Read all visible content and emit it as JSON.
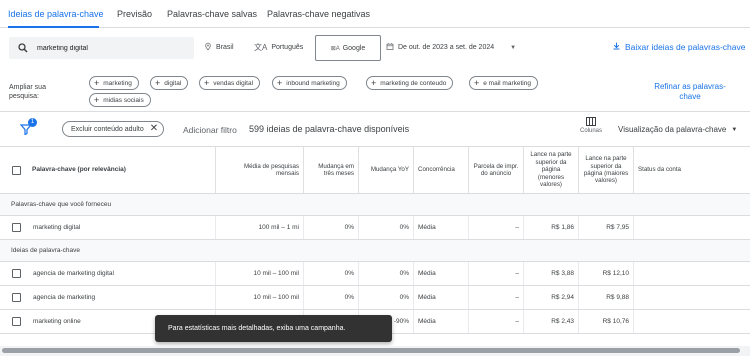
{
  "tabs": [
    {
      "label": "Ideias de palavra-chave",
      "active": true
    },
    {
      "label": "Previsão",
      "active": false
    },
    {
      "label": "Palavras-chave salvas",
      "active": false
    },
    {
      "label": "Palavras-chave negativas",
      "active": false
    }
  ],
  "toolbar": {
    "search_value": "marketing digital",
    "location": "Brasil",
    "language": "Português",
    "source": "Google",
    "date_range": "De out. de 2023 a set. de 2024",
    "download_label": "Baixar ideias de palavras-chave"
  },
  "expand": {
    "label": "Ampliar sua pesquisa:",
    "chips": [
      "marketing",
      "digital",
      "vendas digital",
      "inbound marketing",
      "marketing de conteudo",
      "e mail marketing",
      "midias sociais"
    ],
    "refine_label": "Refinar as palavras-chave"
  },
  "filterbar": {
    "filter_badge": "1",
    "exclude_chip": "Excluir conteúdo adulto",
    "add_filter": "Adicionar filtro",
    "count_text": "599 ideias de palavra-chave disponíveis",
    "columns_label": "Colunas",
    "view_label": "Visualização da palavra-chave"
  },
  "table": {
    "headers": {
      "keyword": "Palavra-chave (por relevância)",
      "avg_searches": "Média de pesquisas mensais",
      "three_month": "Mudança em três meses",
      "yoy": "Mudança YoY",
      "competition": "Concorrência",
      "impr_share": "Parcela de impr. do anúncio",
      "bid_low": "Lance na parte superior da página (menores valores)",
      "bid_high": "Lance na parte superior da página (maiores valores)",
      "status": "Status da conta"
    },
    "section_provided": "Palavras-chave que você forneceu",
    "section_ideas": "Ideias de palavra-chave",
    "rows": [
      {
        "keyword": "marketing digital",
        "avg": "100 mil – 1 mi",
        "three": "0%",
        "yoy": "0%",
        "comp": "Média",
        "impr": "–",
        "low": "R$ 1,86",
        "high": "R$ 7,95"
      },
      {
        "keyword": "agencia de marketing digital",
        "avg": "10 mil – 100 mil",
        "three": "0%",
        "yoy": "0%",
        "comp": "Média",
        "impr": "–",
        "low": "R$ 3,88",
        "high": "R$ 12,10"
      },
      {
        "keyword": "agencia de marketing",
        "avg": "10 mil – 100 mil",
        "three": "0%",
        "yoy": "0%",
        "comp": "Média",
        "impr": "–",
        "low": "R$ 2,94",
        "high": "R$ 9,88"
      },
      {
        "keyword": "marketing online",
        "avg": "",
        "three": "",
        "yoy": "-90%",
        "comp": "Média",
        "impr": "–",
        "low": "R$ 2,43",
        "high": "R$ 10,76"
      }
    ]
  },
  "toast": "Para estatísticas mais detalhadas, exiba uma campanha.",
  "colors": {
    "accent": "#1a73e8",
    "text": "#3c4043",
    "toast_bg": "#323232"
  }
}
